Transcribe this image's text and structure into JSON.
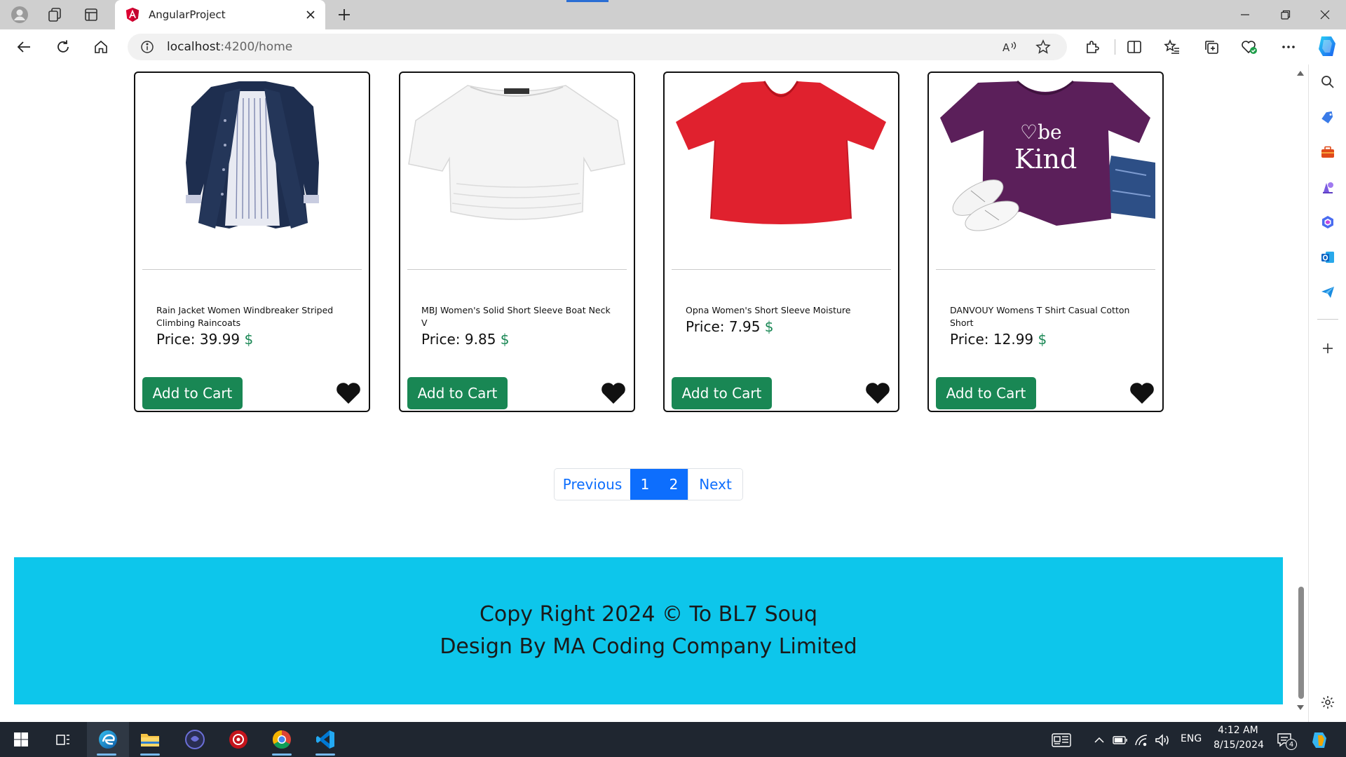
{
  "browser": {
    "tab_title": "AngularProject",
    "url_host": "localhost",
    "url_path": ":4200/home"
  },
  "products": [
    {
      "name": "Rain Jacket Women Windbreaker Striped Climbing Raincoats",
      "price_label": "Price:",
      "price": "39.99",
      "currency": "$",
      "button": "Add to Cart",
      "image": "navy-jacket"
    },
    {
      "name": "MBJ Women's Solid Short Sleeve Boat Neck V",
      "price_label": "Price:",
      "price": "9.85",
      "currency": "$",
      "button": "Add to Cart",
      "image": "white-top"
    },
    {
      "name": "Opna Women's Short Sleeve Moisture",
      "price_label": "Price:",
      "price": "7.95",
      "currency": "$",
      "button": "Add to Cart",
      "image": "red-tshirt"
    },
    {
      "name": "DANVOUY Womens T Shirt Casual Cotton Short",
      "price_label": "Price:",
      "price": "12.99",
      "currency": "$",
      "button": "Add to Cart",
      "image": "purple-be-kind-tshirt",
      "print_text": "be Kind"
    }
  ],
  "pagination": {
    "previous": "Previous",
    "pages": [
      "1",
      "2"
    ],
    "next": "Next"
  },
  "footer": {
    "line1": "Copy Right 2024 © To BL7 Souq",
    "line2": "Design By MA Coding Company Limited"
  },
  "taskbar": {
    "language": "ENG",
    "time": "4:12 AM",
    "date": "8/15/2024",
    "notification_count": "4"
  },
  "colors": {
    "cart_button": "#198754",
    "pagination_active": "#0d6efd",
    "footer_bg": "#0dc6eb",
    "currency": "#198754"
  }
}
